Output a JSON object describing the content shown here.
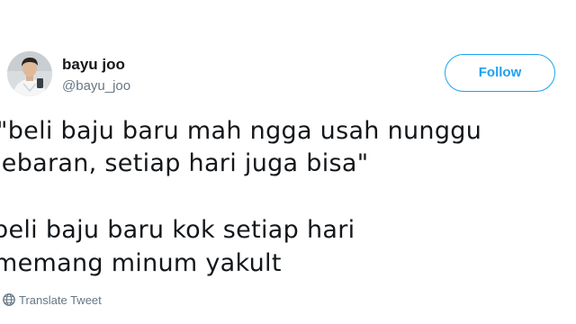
{
  "user": {
    "display_name": "bayu joo",
    "handle": "@bayu_joo"
  },
  "follow_button": {
    "label": "Follow"
  },
  "tweet": {
    "lines": [
      "\"beli baju baru mah ngga usah nunggu",
      "lebaran, setiap hari juga bisa\"",
      "beli baju baru kok setiap hari",
      "memang minum yakult"
    ]
  },
  "translate": {
    "label": "Translate Tweet",
    "icon": "globe-icon"
  },
  "colors": {
    "accent": "#1da1f2",
    "text_primary": "#14171a",
    "text_secondary": "#657786"
  }
}
